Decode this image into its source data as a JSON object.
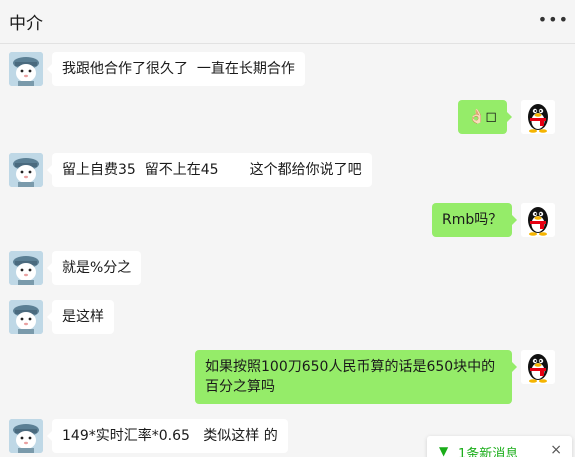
{
  "window": {
    "title": "中介",
    "more_icon": "•••"
  },
  "messages": [
    {
      "from": "contact",
      "text": "我跟他合作了很久了  一直在长期合作"
    },
    {
      "from": "me",
      "text": "👌🏻◻"
    },
    {
      "from": "contact",
      "text": "留上自费35  留不上在45       这个都给你说了吧"
    },
    {
      "from": "me",
      "text": "Rmb吗？"
    },
    {
      "from": "contact",
      "text": "就是%分之"
    },
    {
      "from": "contact",
      "text": "是这样"
    },
    {
      "from": "me",
      "text": "如果按照100刀650人民币算的话是650块中的百分之算吗"
    },
    {
      "from": "contact",
      "text": "149*实时汇率*0.65   类似这样 的"
    }
  ],
  "new_message_toast": {
    "text": "1条新消息",
    "arrow_icon": "▼",
    "close_icon": "×"
  },
  "colors": {
    "sent_bubble": "#95ec69",
    "received_bubble": "#ffffff",
    "background": "#f5f5f5",
    "toast_text": "#1aad19"
  }
}
